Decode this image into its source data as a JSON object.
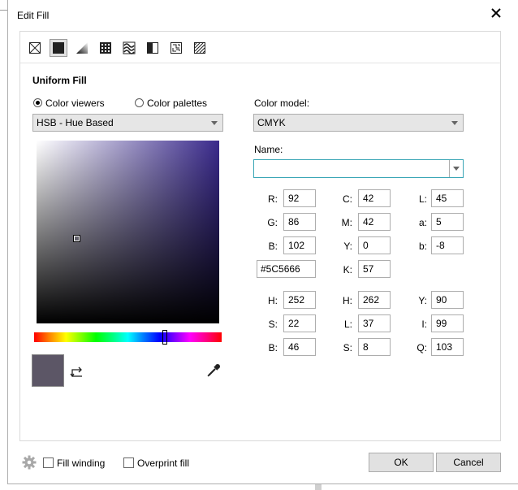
{
  "window": {
    "title": "Edit Fill"
  },
  "toolbar": {
    "icons": [
      "no-fill-icon",
      "uniform-fill-icon",
      "fountain-fill-icon",
      "vector-pattern-fill-icon",
      "bitmap-pattern-fill-icon",
      "two-color-pattern-fill-icon",
      "texture-fill-icon",
      "postscript-fill-icon"
    ],
    "selected": "uniform-fill-icon"
  },
  "section": {
    "title": "Uniform Fill"
  },
  "viewer": {
    "color_viewers": "Color viewers",
    "color_palettes": "Color palettes",
    "selected": "color_viewers",
    "mode": "HSB - Hue Based"
  },
  "color_model": {
    "label": "Color model:",
    "value": "CMYK"
  },
  "name": {
    "label": "Name:",
    "value": ""
  },
  "rgb": {
    "r_label": "R:",
    "r": "92",
    "g_label": "G:",
    "g": "86",
    "b_label": "B:",
    "b": "102"
  },
  "cmyk": {
    "c_label": "C:",
    "c": "42",
    "m_label": "M:",
    "m": "42",
    "y_label": "Y:",
    "y": "0",
    "k_label": "K:",
    "k": "57"
  },
  "lab": {
    "l_label": "L:",
    "l": "45",
    "a_label": "a:",
    "a": "5",
    "b_label": "b:",
    "b": "-8"
  },
  "hex": "#5C5666",
  "hsb": {
    "h_label": "H:",
    "h": "252",
    "s_label": "S:",
    "s": "22",
    "b_label": "B:",
    "b": "46"
  },
  "hls": {
    "h_label": "H:",
    "h": "262",
    "l_label": "L:",
    "l": "37",
    "s_label": "S:",
    "s": "8"
  },
  "yiq": {
    "y_label": "Y:",
    "y": "90",
    "i_label": "I:",
    "i": "99",
    "q_label": "Q:",
    "q": "103"
  },
  "colors": {
    "current": "#5c5666",
    "hue_base": "#3a2a8c",
    "accent": "#3aa6b6"
  },
  "footer": {
    "fill_winding": "Fill winding",
    "overprint_fill": "Overprint fill",
    "ok": "OK",
    "cancel": "Cancel"
  }
}
